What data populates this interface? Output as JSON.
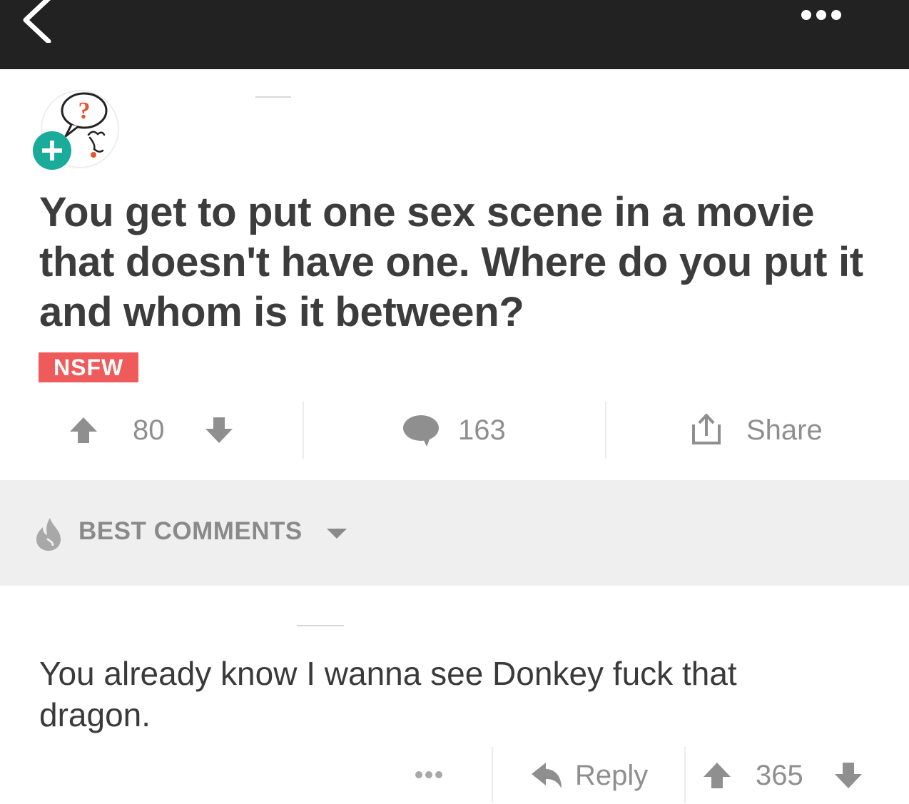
{
  "post": {
    "title": "You get to put one sex scene in a movie that doesn't have one. Where do you put it and whom is it between?",
    "nsfw_label": "NSFW",
    "score": "80",
    "comment_count": "163",
    "share_label": "Share"
  },
  "comments_header": {
    "sort_label": "BEST COMMENTS"
  },
  "comment": {
    "body": "You already know I wanna see Donkey fuck that dragon.",
    "reply_label": "Reply",
    "score": "365"
  },
  "colors": {
    "topbar": "#222222",
    "nsfw": "#ef5a5a",
    "muted_text": "#8f8f8f",
    "title_text": "#3c3c3c",
    "section_bg": "#efefef",
    "avatar_plus": "#1aab9b",
    "avatar_question": "#e8552d"
  },
  "icons": {
    "back": "chevron-left-icon",
    "more": "ellipsis-icon",
    "upvote": "arrow-up-icon",
    "downvote": "arrow-down-icon",
    "comments": "speech-bubble-icon",
    "share": "share-icon",
    "sort": "flame-icon",
    "dropdown": "caret-down-icon",
    "reply": "reply-arrow-icon"
  }
}
